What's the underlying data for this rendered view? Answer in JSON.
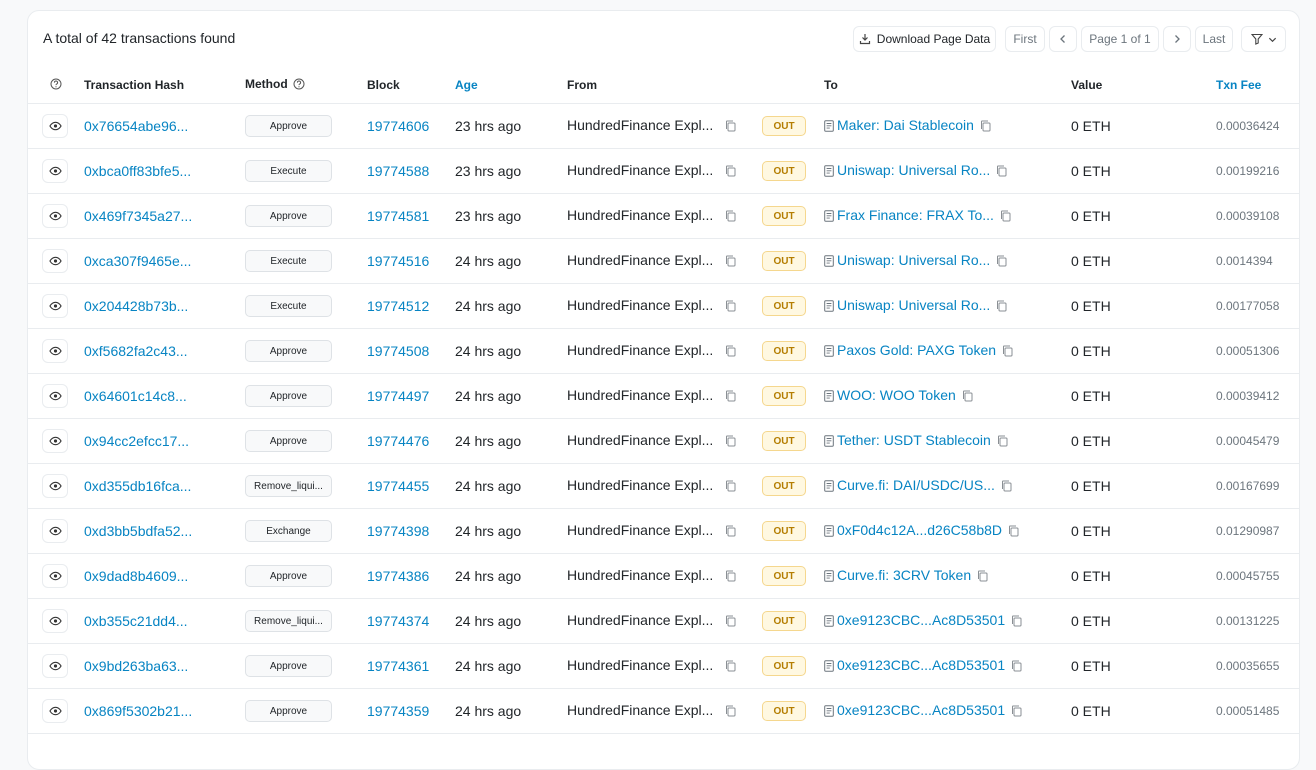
{
  "summary": "A total of 42 transactions found",
  "toolbar": {
    "download_label": "Download Page Data",
    "first_label": "First",
    "page_label": "Page 1 of 1",
    "last_label": "Last"
  },
  "columns": {
    "hash": "Transaction Hash",
    "method": "Method",
    "block": "Block",
    "age": "Age",
    "from": "From",
    "to": "To",
    "value": "Value",
    "fee": "Txn Fee"
  },
  "direction_label": "OUT",
  "rows": [
    {
      "hash": "0x76654abe96...",
      "method": "Approve",
      "block": "19774606",
      "age": "23 hrs ago",
      "from": "HundredFinance Expl...",
      "to": "Maker: Dai Stablecoin",
      "value": "0 ETH",
      "fee": "0.00036424"
    },
    {
      "hash": "0xbca0ff83bfe5...",
      "method": "Execute",
      "block": "19774588",
      "age": "23 hrs ago",
      "from": "HundredFinance Expl...",
      "to": "Uniswap: Universal Ro...",
      "value": "0 ETH",
      "fee": "0.00199216"
    },
    {
      "hash": "0x469f7345a27...",
      "method": "Approve",
      "block": "19774581",
      "age": "23 hrs ago",
      "from": "HundredFinance Expl...",
      "to": "Frax Finance: FRAX To...",
      "value": "0 ETH",
      "fee": "0.00039108"
    },
    {
      "hash": "0xca307f9465e...",
      "method": "Execute",
      "block": "19774516",
      "age": "24 hrs ago",
      "from": "HundredFinance Expl...",
      "to": "Uniswap: Universal Ro...",
      "value": "0 ETH",
      "fee": "0.0014394"
    },
    {
      "hash": "0x204428b73b...",
      "method": "Execute",
      "block": "19774512",
      "age": "24 hrs ago",
      "from": "HundredFinance Expl...",
      "to": "Uniswap: Universal Ro...",
      "value": "0 ETH",
      "fee": "0.00177058"
    },
    {
      "hash": "0xf5682fa2c43...",
      "method": "Approve",
      "block": "19774508",
      "age": "24 hrs ago",
      "from": "HundredFinance Expl...",
      "to": "Paxos Gold: PAXG Token",
      "value": "0 ETH",
      "fee": "0.00051306"
    },
    {
      "hash": "0x64601c14c8...",
      "method": "Approve",
      "block": "19774497",
      "age": "24 hrs ago",
      "from": "HundredFinance Expl...",
      "to": "WOO: WOO Token",
      "value": "0 ETH",
      "fee": "0.00039412"
    },
    {
      "hash": "0x94cc2efcc17...",
      "method": "Approve",
      "block": "19774476",
      "age": "24 hrs ago",
      "from": "HundredFinance Expl...",
      "to": "Tether: USDT Stablecoin",
      "value": "0 ETH",
      "fee": "0.00045479"
    },
    {
      "hash": "0xd355db16fca...",
      "method": "Remove_liqui...",
      "block": "19774455",
      "age": "24 hrs ago",
      "from": "HundredFinance Expl...",
      "to": "Curve.fi: DAI/USDC/US...",
      "value": "0 ETH",
      "fee": "0.00167699"
    },
    {
      "hash": "0xd3bb5bdfa52...",
      "method": "Exchange",
      "block": "19774398",
      "age": "24 hrs ago",
      "from": "HundredFinance Expl...",
      "to": "0xF0d4c12A...d26C58b8D",
      "value": "0 ETH",
      "fee": "0.01290987"
    },
    {
      "hash": "0x9dad8b4609...",
      "method": "Approve",
      "block": "19774386",
      "age": "24 hrs ago",
      "from": "HundredFinance Expl...",
      "to": "Curve.fi: 3CRV Token",
      "value": "0 ETH",
      "fee": "0.00045755"
    },
    {
      "hash": "0xb355c21dd4...",
      "method": "Remove_liqui...",
      "block": "19774374",
      "age": "24 hrs ago",
      "from": "HundredFinance Expl...",
      "to": "0xe9123CBC...Ac8D53501",
      "value": "0 ETH",
      "fee": "0.00131225"
    },
    {
      "hash": "0x9bd263ba63...",
      "method": "Approve",
      "block": "19774361",
      "age": "24 hrs ago",
      "from": "HundredFinance Expl...",
      "to": "0xe9123CBC...Ac8D53501",
      "value": "0 ETH",
      "fee": "0.00035655"
    },
    {
      "hash": "0x869f5302b21...",
      "method": "Approve",
      "block": "19774359",
      "age": "24 hrs ago",
      "from": "HundredFinance Expl...",
      "to": "0xe9123CBC...Ac8D53501",
      "value": "0 ETH",
      "fee": "0.00051485"
    }
  ],
  "icons": {
    "download": "download-icon",
    "prev": "chevron-left-icon",
    "next": "chevron-right-icon",
    "filter": "filter-icon",
    "eye": "eye-icon",
    "copy": "copy-icon",
    "contract": "document-icon",
    "help": "question-circle-icon"
  },
  "colors": {
    "link": "#0784c3",
    "out_bg": "#fff8e1",
    "out_text": "#b47d00",
    "border": "#e9ecef"
  }
}
